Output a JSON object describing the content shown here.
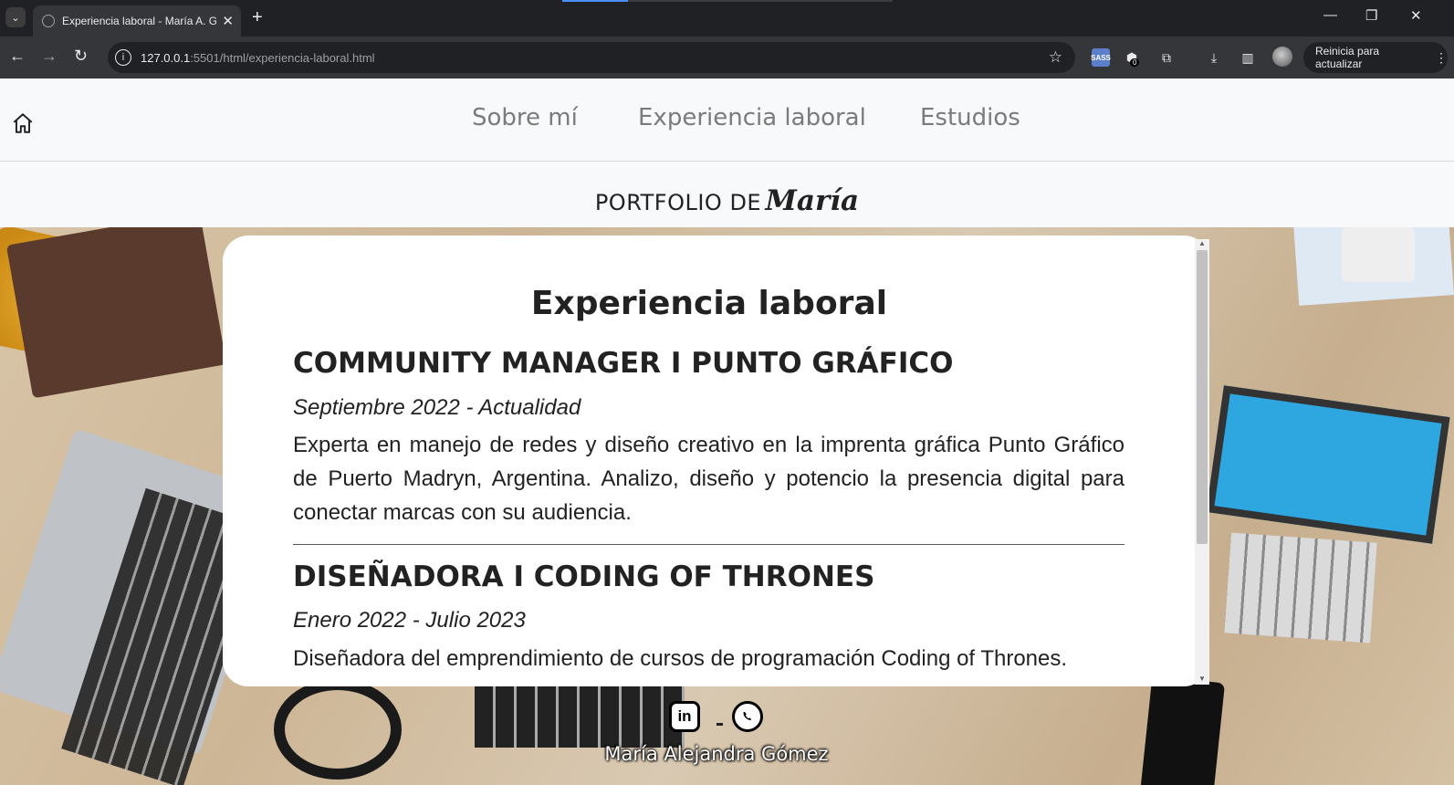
{
  "browser": {
    "tab_title": "Experiencia laboral - María A. G",
    "url_host": "127.0.0.1",
    "url_rest": ":5501/html/experiencia-laboral.html",
    "extension_badge": "0",
    "update_button": "Reinicia para actualizar",
    "sass_label": "SASS"
  },
  "nav": {
    "links": [
      "Sobre mí",
      "Experiencia laboral",
      "Estudios"
    ]
  },
  "brand": {
    "prefix": "PORTFOLIO DE",
    "name": "María"
  },
  "main": {
    "title": "Experiencia laboral",
    "jobs": [
      {
        "title": "COMMUNITY MANAGER I PUNTO GRÁFICO",
        "date": "Septiembre 2022 - Actualidad",
        "description": "Experta en manejo de redes y diseño creativo en la imprenta gráfica Punto Gráfico de Puerto Madryn, Argentina. Analizo, diseño y potencio la presencia digital para conectar marcas con su audiencia."
      },
      {
        "title": "DISEÑADORA I CODING OF THRONES",
        "date": "Enero 2022 - Julio 2023",
        "description": "Diseñadora del emprendimiento de cursos de programación Coding of Thrones."
      }
    ]
  },
  "footer": {
    "name": "María Alejandra Gómez",
    "linkedin_label": "in"
  },
  "colors": {
    "nav_text": "#7b7b7b",
    "card_bg": "#ffffff",
    "chrome_dark": "#202124",
    "chrome_toolbar": "#35363a",
    "load_accent": "#4a8ef7"
  }
}
